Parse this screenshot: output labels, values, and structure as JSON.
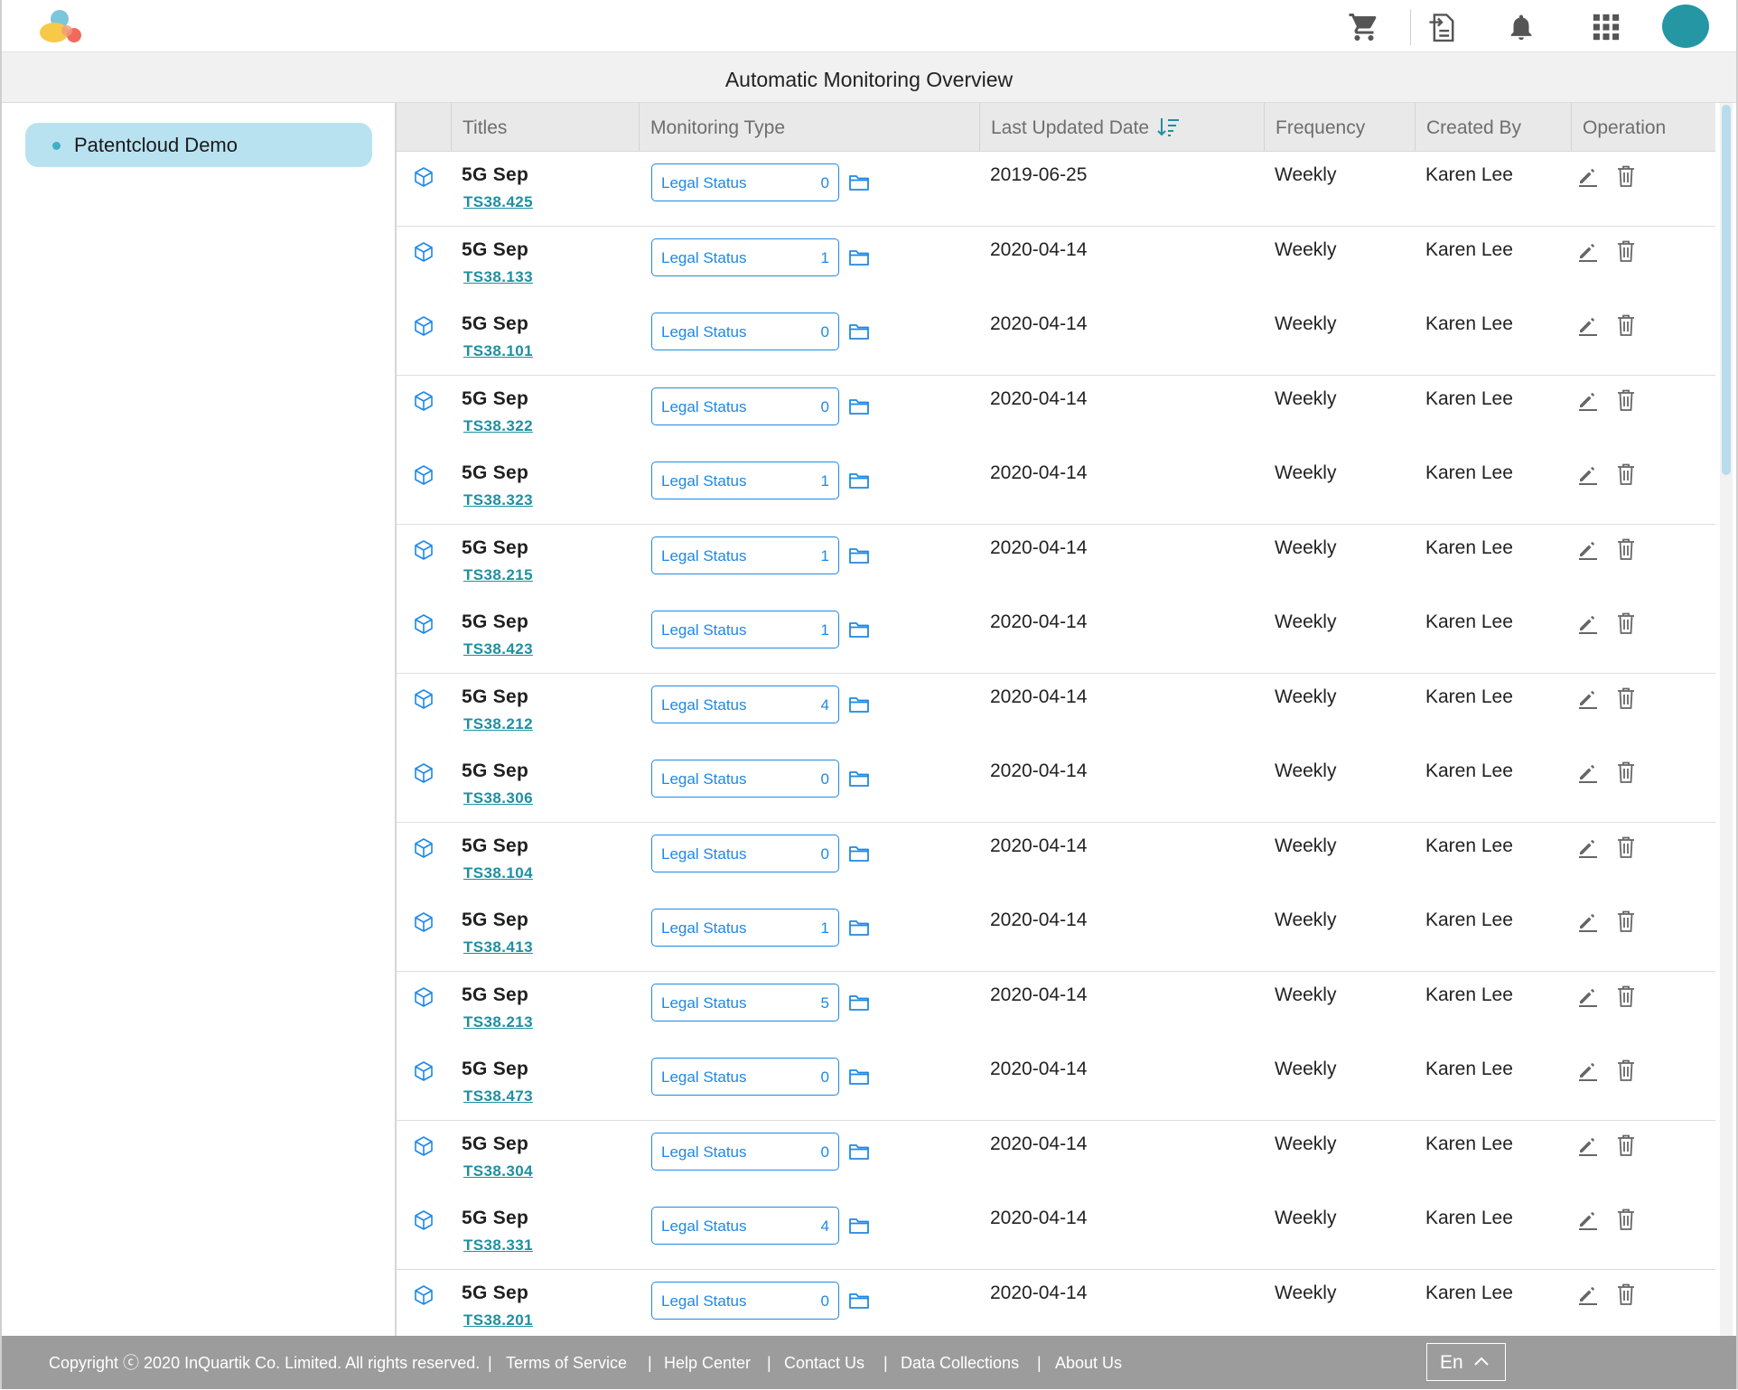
{
  "header": {
    "icons": [
      "logo",
      "cart-icon",
      "export-icon",
      "bell-icon",
      "apps-grid-icon",
      "avatar"
    ],
    "avatar_color": "#2596a3"
  },
  "page_title": "Automatic Monitoring Overview",
  "sidebar": {
    "items": [
      {
        "label": "Patentcloud Demo",
        "selected": true
      }
    ]
  },
  "table": {
    "columns": {
      "titles": "Titles",
      "monitoring_type": "Monitoring Type",
      "last_updated": "Last Updated Date",
      "frequency": "Frequency",
      "created_by": "Created By",
      "operation": "Operation"
    },
    "sort": {
      "column": "last_updated",
      "icon": "sort-desc-icon"
    },
    "rows": [
      {
        "title": "5G Sep",
        "link": "TS38.425",
        "type": "Legal Status",
        "count": "0",
        "date": "2019-06-25",
        "frequency": "Weekly",
        "creator": "Karen Lee"
      },
      {
        "title": "5G Sep",
        "link": "TS38.133",
        "type": "Legal Status",
        "count": "1",
        "date": "2020-04-14",
        "frequency": "Weekly",
        "creator": "Karen Lee"
      },
      {
        "title": "5G Sep",
        "link": "TS38.101",
        "type": "Legal Status",
        "count": "0",
        "date": "2020-04-14",
        "frequency": "Weekly",
        "creator": "Karen Lee"
      },
      {
        "title": "5G Sep",
        "link": "TS38.322",
        "type": "Legal Status",
        "count": "0",
        "date": "2020-04-14",
        "frequency": "Weekly",
        "creator": "Karen Lee"
      },
      {
        "title": "5G Sep",
        "link": "TS38.323",
        "type": "Legal Status",
        "count": "1",
        "date": "2020-04-14",
        "frequency": "Weekly",
        "creator": "Karen Lee"
      },
      {
        "title": "5G Sep",
        "link": "TS38.215",
        "type": "Legal Status",
        "count": "1",
        "date": "2020-04-14",
        "frequency": "Weekly",
        "creator": "Karen Lee"
      },
      {
        "title": "5G Sep",
        "link": "TS38.423",
        "type": "Legal Status",
        "count": "1",
        "date": "2020-04-14",
        "frequency": "Weekly",
        "creator": "Karen Lee"
      },
      {
        "title": "5G Sep",
        "link": "TS38.212",
        "type": "Legal Status",
        "count": "4",
        "date": "2020-04-14",
        "frequency": "Weekly",
        "creator": "Karen Lee"
      },
      {
        "title": "5G Sep",
        "link": "TS38.306",
        "type": "Legal Status",
        "count": "0",
        "date": "2020-04-14",
        "frequency": "Weekly",
        "creator": "Karen Lee"
      },
      {
        "title": "5G Sep",
        "link": "TS38.104",
        "type": "Legal Status",
        "count": "0",
        "date": "2020-04-14",
        "frequency": "Weekly",
        "creator": "Karen Lee"
      },
      {
        "title": "5G Sep",
        "link": "TS38.413",
        "type": "Legal Status",
        "count": "1",
        "date": "2020-04-14",
        "frequency": "Weekly",
        "creator": "Karen Lee"
      },
      {
        "title": "5G Sep",
        "link": "TS38.213",
        "type": "Legal Status",
        "count": "5",
        "date": "2020-04-14",
        "frequency": "Weekly",
        "creator": "Karen Lee"
      },
      {
        "title": "5G Sep",
        "link": "TS38.473",
        "type": "Legal Status",
        "count": "0",
        "date": "2020-04-14",
        "frequency": "Weekly",
        "creator": "Karen Lee"
      },
      {
        "title": "5G Sep",
        "link": "TS38.304",
        "type": "Legal Status",
        "count": "0",
        "date": "2020-04-14",
        "frequency": "Weekly",
        "creator": "Karen Lee"
      },
      {
        "title": "5G Sep",
        "link": "TS38.331",
        "type": "Legal Status",
        "count": "4",
        "date": "2020-04-14",
        "frequency": "Weekly",
        "creator": "Karen Lee"
      },
      {
        "title": "5G Sep",
        "link": "TS38.201",
        "type": "Legal Status",
        "count": "0",
        "date": "2020-04-14",
        "frequency": "Weekly",
        "creator": "Karen Lee"
      }
    ]
  },
  "footer": {
    "copyright": "Copyright ⓒ 2020 InQuartik Co. Limited. All rights reserved.",
    "links": [
      "Terms of Service",
      "Help Center",
      "Contact Us",
      "Data Collections",
      "About Us"
    ],
    "language": "En"
  },
  "colors": {
    "accent_blue": "#1e88e5",
    "link_teal": "#1f8fa0",
    "sidebar_selected": "#b9e2f1",
    "footer_bg": "#9c9c9c"
  }
}
